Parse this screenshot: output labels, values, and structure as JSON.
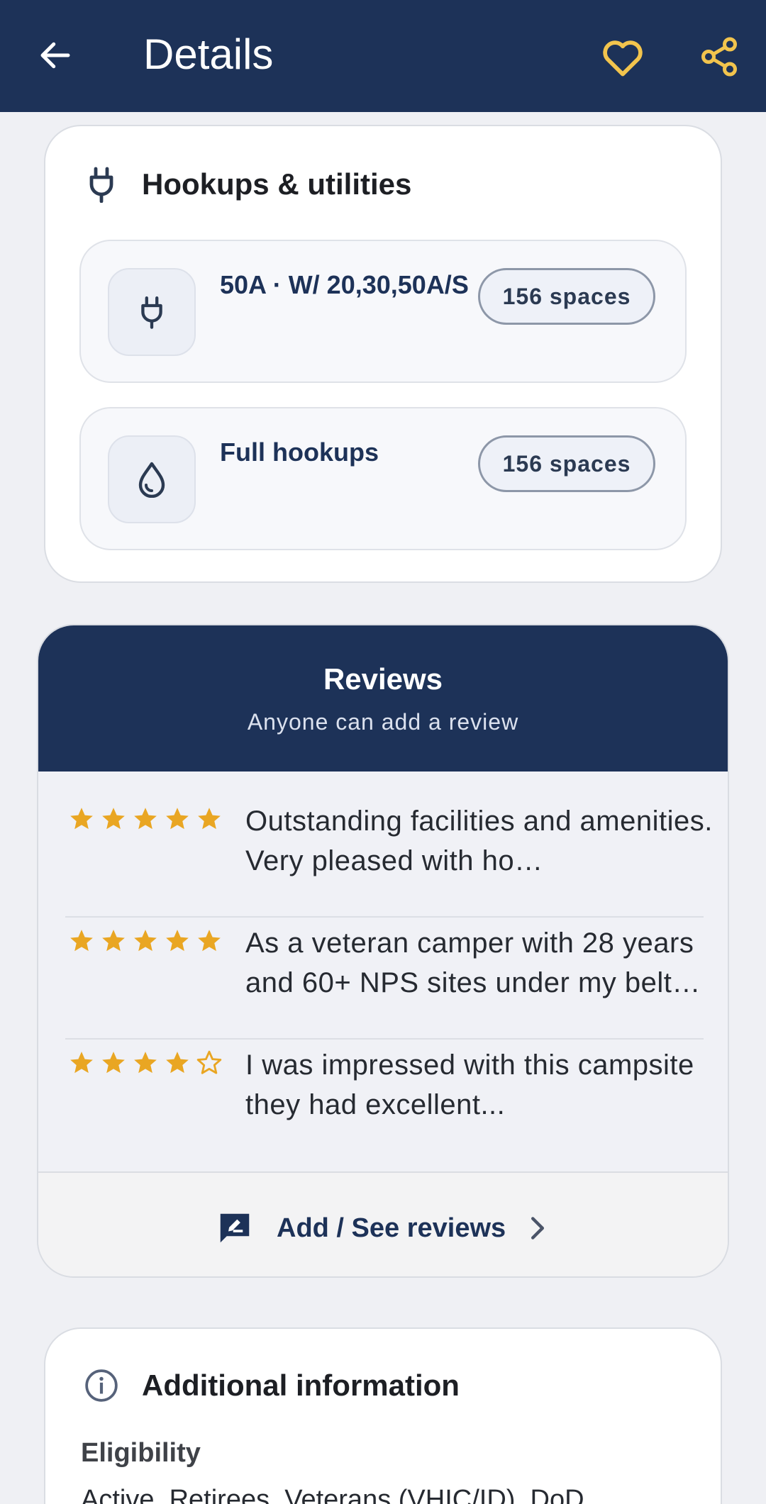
{
  "header": {
    "title": "Details"
  },
  "hookups": {
    "title": "Hookups & utilities",
    "items": [
      {
        "label": "50A · W/ 20,30,50A/S",
        "count": "156 spaces",
        "icon": "plug-icon"
      },
      {
        "label": "Full hookups",
        "count": "156 spaces",
        "icon": "water-drop-icon"
      }
    ]
  },
  "reviews": {
    "title": "Reviews",
    "subtitle": "Anyone can add a review",
    "items": [
      {
        "rating": 5,
        "text": "Outstanding facilities and amenities. Very pleased with ho…"
      },
      {
        "rating": 5,
        "text": "As a veteran camper with 28 years and 60+ NPS sites under my belt…"
      },
      {
        "rating": 4,
        "text": "I was impressed with this campsite they had excellent..."
      }
    ],
    "action": "Add / See reviews"
  },
  "additional": {
    "title": "Additional information",
    "eligibility_label": "Eligibility",
    "eligibility_value": "Active, Retirees, Veterans (VHIC/ID), DoD"
  },
  "colors": {
    "navy": "#1d3258",
    "gold": "#e9a623",
    "heart": "#f2c44d"
  }
}
